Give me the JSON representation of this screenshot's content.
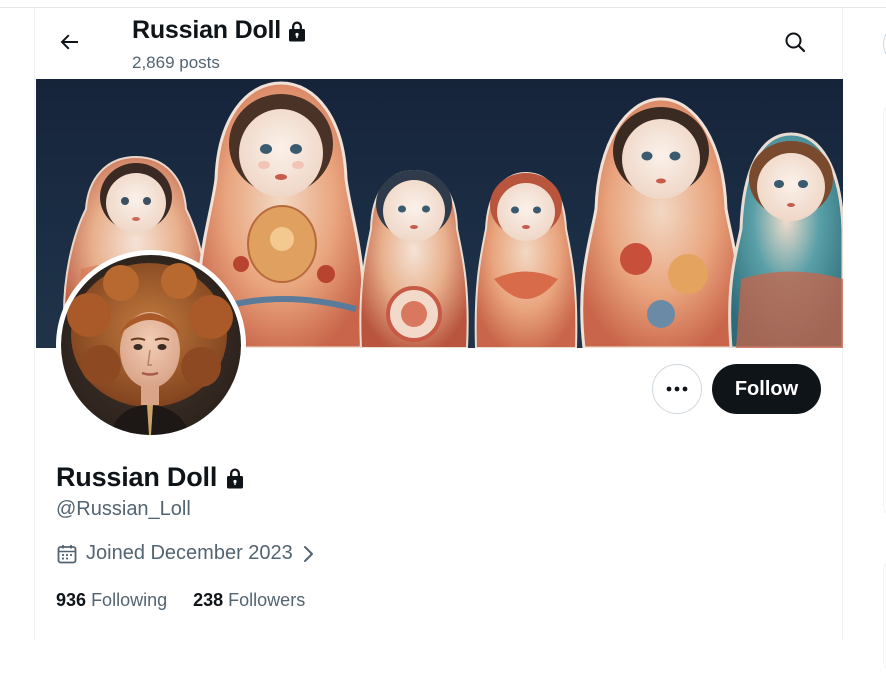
{
  "header": {
    "title": "Russian Doll",
    "posts_count": "2,869 posts"
  },
  "profile": {
    "display_name": "Russian Doll",
    "handle": "@Russian_Loll",
    "joined": "Joined December 2023",
    "following_count": "936",
    "following_label": "Following",
    "followers_count": "238",
    "followers_label": "Followers"
  },
  "actions": {
    "follow_label": "Follow"
  },
  "icons": {
    "back": "arrow-left-icon",
    "search": "search-icon",
    "lock": "lock-icon",
    "more": "more-horizontal-icon",
    "calendar": "calendar-icon",
    "chevron": "chevron-right-icon"
  },
  "colors": {
    "text_primary": "#0f1419",
    "text_secondary": "#536471",
    "follow_bg": "#0f1419",
    "banner_bg": "#16243a"
  }
}
